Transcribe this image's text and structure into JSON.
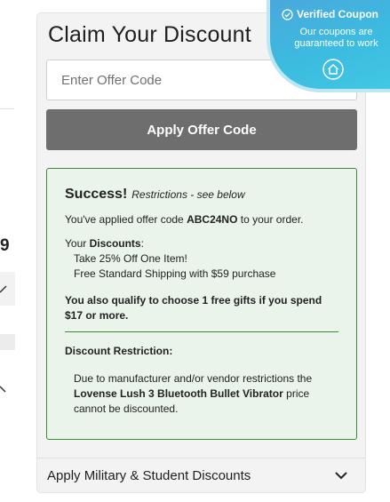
{
  "left_fragment": {
    "number": "9"
  },
  "title": "Claim Your Discount",
  "offer_input": {
    "placeholder": "Enter Offer Code",
    "value": ""
  },
  "apply_button": "Apply Offer Code",
  "success": {
    "title": "Success!",
    "restrictions_note": "Restrictions - see below",
    "applied_prefix": "You've applied offer code",
    "code": "ABC24NO",
    "applied_suffix": "to your order.",
    "your_label": "Your",
    "discounts_label": "Discounts",
    "colon": ":",
    "discounts": [
      "Take 25% Off One Item!",
      "Free Standard Shipping with $59 purchase"
    ],
    "free_gifts": "You also qualify to choose 1 free gifts if you spend $17 or more.",
    "restriction_title": "Discount Restriction:",
    "restriction_prefix": "Due to manufacturer and/or vendor restrictions the",
    "product": "Lovense Lush 3 Bluetooth Bullet Vibrator",
    "restriction_suffix": "price cannot be discounted."
  },
  "military_label": "Apply Military & Student Discounts",
  "badge": {
    "title": "Verified Coupon",
    "subtitle_line1": "Our coupons are",
    "subtitle_line2": "guaranteed to work"
  },
  "icons": [
    "check-circle-icon",
    "house-icon",
    "chevron-down-icon"
  ],
  "colors": {
    "success_border": "#3a8a3a",
    "success_bg": "#eaf4ea",
    "button_bg": "#6e6e6e",
    "badge_bg": "#3bbde0"
  }
}
